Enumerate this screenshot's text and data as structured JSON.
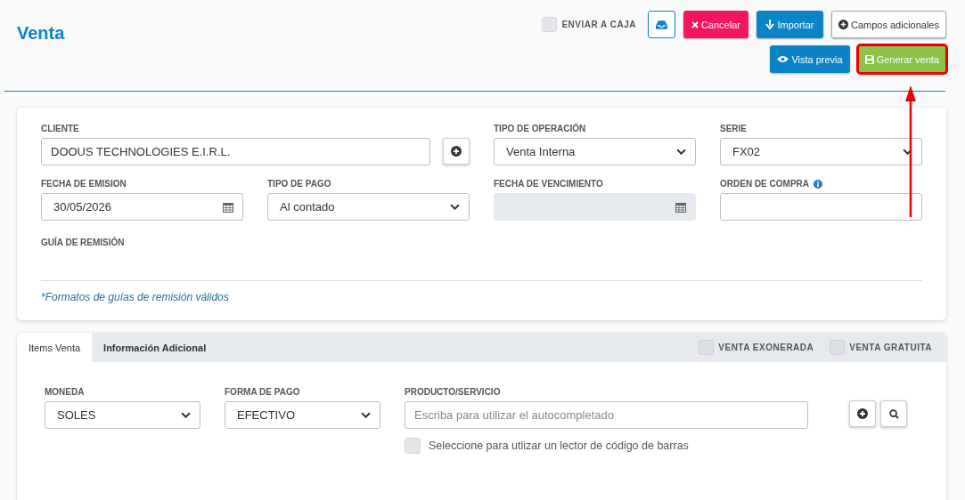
{
  "title": "Venta",
  "toolbar": {
    "send_to_cash": {
      "label": "ENVIAR A CAJA",
      "checked": false
    },
    "top_buttons": [
      {
        "kind": "inbox"
      },
      {
        "kind": "cancel",
        "label": "Cancelar",
        "highlighted": false
      },
      {
        "kind": "import",
        "label": "Importar",
        "highlighted": false
      },
      {
        "kind": "extra",
        "label": "Campos adicionales",
        "highlighted": false
      }
    ],
    "bottom_buttons": [
      {
        "kind": "preview",
        "label": "Vista previa",
        "highlighted": false
      },
      {
        "kind": "save",
        "label": "Generar venta",
        "highlighted": true
      }
    ]
  },
  "form": {
    "fields": [
      {
        "kind": "client",
        "label": "CLIENTE",
        "value": "DOOUS TECHNOLOGIES E.I.R.L."
      },
      {
        "kind": "select",
        "label": "TIPO DE OPERACIÓN",
        "value": "Venta Interna"
      },
      {
        "kind": "select",
        "label": "SERIE",
        "value": "FX02"
      },
      {
        "kind": "date",
        "label": "FECHA DE EMISION",
        "value": "30/05/2026",
        "disabled": false
      },
      {
        "kind": "select",
        "label": "TIPO DE PAGO",
        "value": "Al contado"
      },
      {
        "kind": "date",
        "label": "FECHA DE VENCIMIENTO",
        "disabled": true
      },
      {
        "kind": "input",
        "label": "ORDEN DE COMPRA",
        "info": true
      }
    ],
    "guide_label": "GUÍA DE REMISIÓN",
    "guide_link": "*Formatos de guías de remisión válidos"
  },
  "items": {
    "tabs": [
      {
        "label": "Items Venta",
        "selected": true
      },
      {
        "label": "Información Adicional",
        "selected": false
      }
    ],
    "toggles": [
      {
        "label": "VENTA EXONERADA",
        "checked": false
      },
      {
        "label": "VENTA GRATUITA",
        "checked": false
      }
    ],
    "currency": {
      "label": "MONEDA",
      "value": "SOLES"
    },
    "payment": {
      "label": "FORMA DE PAGO",
      "value": "EFECTIVO"
    },
    "product": {
      "label": "PRODUCTO/SERVICIO",
      "placeholder": "Escriba para utilizar el autocompletado"
    },
    "barcode": {
      "label": "Seleccione para utlizar un lector de código de barras",
      "checked": false
    }
  }
}
